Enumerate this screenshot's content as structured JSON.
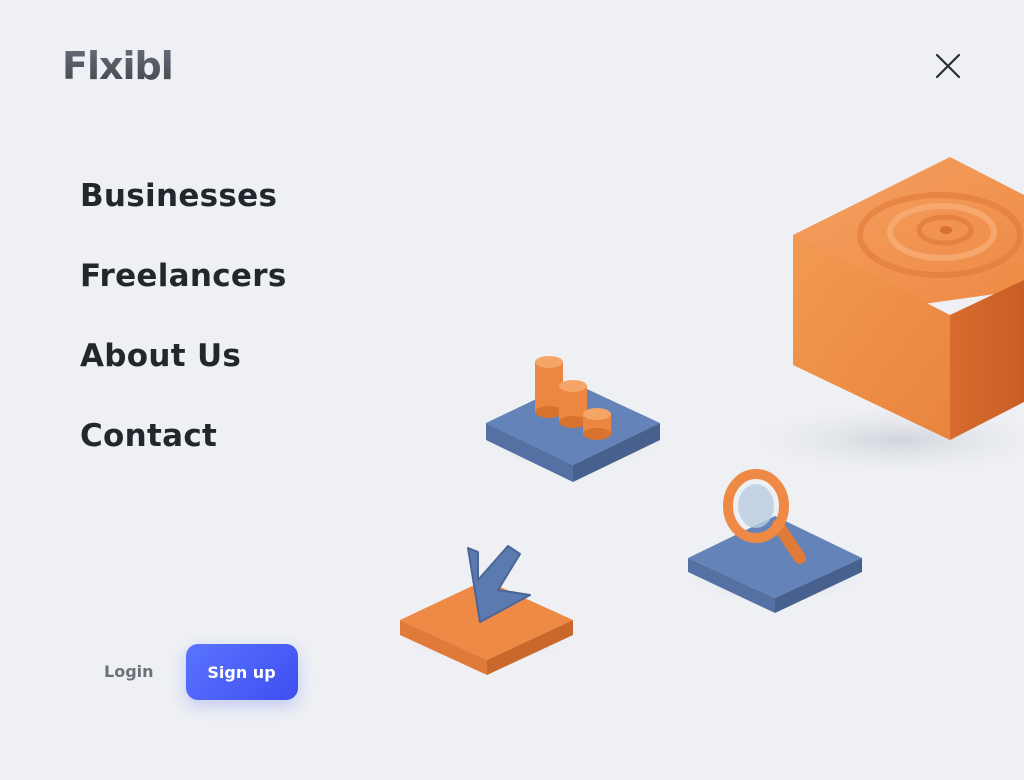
{
  "brand": {
    "logo_text": "Flxibl"
  },
  "header": {
    "close_icon": "close-icon"
  },
  "nav": {
    "items": [
      {
        "label": "Businesses"
      },
      {
        "label": "Freelancers"
      },
      {
        "label": "About Us"
      },
      {
        "label": "Contact"
      }
    ]
  },
  "actions": {
    "login_label": "Login",
    "signup_label": "Sign up"
  },
  "colors": {
    "background": "#eef0f4",
    "accent_orange": "#ee8a45",
    "accent_blue": "#5b7bb0",
    "primary_button": "#4a5cf5",
    "text_dark": "#23262c"
  },
  "illustration": {
    "icons": [
      "cube-icon",
      "bar-chart-icon",
      "magnifier-icon",
      "download-arrow-icon"
    ]
  }
}
